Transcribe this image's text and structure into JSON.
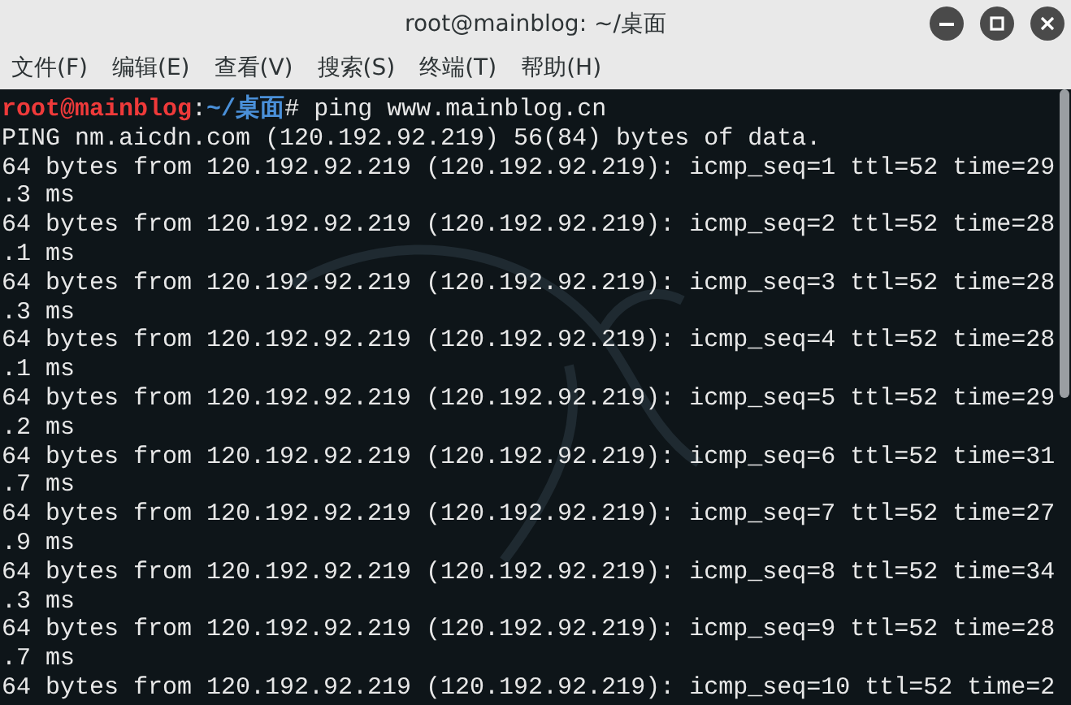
{
  "window": {
    "title": "root@mainblog: ~/桌面"
  },
  "menu": [
    "文件(F)",
    "编辑(E)",
    "查看(V)",
    "搜索(S)",
    "终端(T)",
    "帮助(H)"
  ],
  "terminal": {
    "lines": [
      {
        "kind": "prompt",
        "user": "root@mainblog",
        "separator": ":",
        "path": "~/桌面",
        "command": "# ping www.mainblog.cn"
      },
      {
        "kind": "output",
        "text": "PING nm.aicdn.com (120.192.92.219) 56(84) bytes of data."
      },
      {
        "kind": "output",
        "text": "64 bytes from 120.192.92.219 (120.192.92.219): icmp_seq=1 ttl=52 time=29"
      },
      {
        "kind": "output",
        "text": ".3 ms"
      },
      {
        "kind": "output",
        "text": "64 bytes from 120.192.92.219 (120.192.92.219): icmp_seq=2 ttl=52 time=28"
      },
      {
        "kind": "output",
        "text": ".1 ms"
      },
      {
        "kind": "output",
        "text": "64 bytes from 120.192.92.219 (120.192.92.219): icmp_seq=3 ttl=52 time=28"
      },
      {
        "kind": "output",
        "text": ".3 ms"
      },
      {
        "kind": "output",
        "text": "64 bytes from 120.192.92.219 (120.192.92.219): icmp_seq=4 ttl=52 time=28"
      },
      {
        "kind": "output",
        "text": ".1 ms"
      },
      {
        "kind": "output",
        "text": "64 bytes from 120.192.92.219 (120.192.92.219): icmp_seq=5 ttl=52 time=29"
      },
      {
        "kind": "output",
        "text": ".2 ms"
      },
      {
        "kind": "output",
        "text": "64 bytes from 120.192.92.219 (120.192.92.219): icmp_seq=6 ttl=52 time=31"
      },
      {
        "kind": "output",
        "text": ".7 ms"
      },
      {
        "kind": "output",
        "text": "64 bytes from 120.192.92.219 (120.192.92.219): icmp_seq=7 ttl=52 time=27"
      },
      {
        "kind": "output",
        "text": ".9 ms"
      },
      {
        "kind": "output",
        "text": "64 bytes from 120.192.92.219 (120.192.92.219): icmp_seq=8 ttl=52 time=34"
      },
      {
        "kind": "output",
        "text": ".3 ms"
      },
      {
        "kind": "output",
        "text": "64 bytes from 120.192.92.219 (120.192.92.219): icmp_seq=9 ttl=52 time=28"
      },
      {
        "kind": "output",
        "text": ".7 ms"
      },
      {
        "kind": "output",
        "text": "64 bytes from 120.192.92.219 (120.192.92.219): icmp_seq=10 ttl=52 time=2"
      }
    ]
  }
}
